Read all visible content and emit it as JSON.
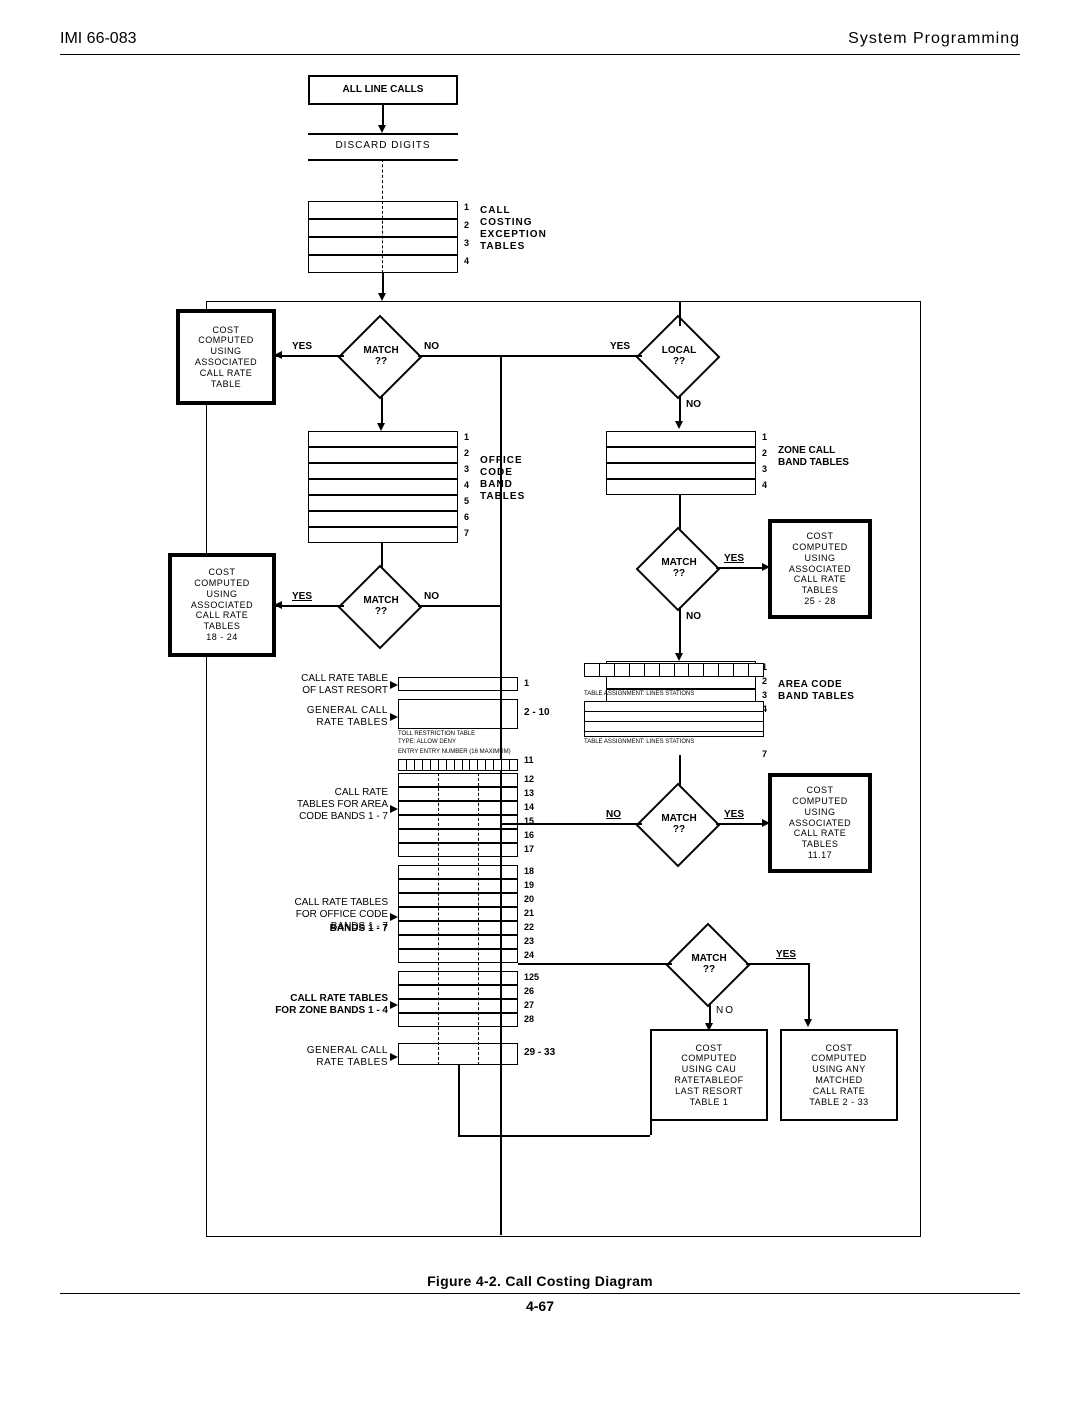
{
  "header": {
    "left": "IMI 66-083",
    "right": "System Programming"
  },
  "caption": "Figure 4-2. Call Costing Diagram",
  "page_number": "4-67",
  "start": "ALL LINE CALLS",
  "step_discard": "DISCARD DIGITS",
  "labels": {
    "call_costing_exception": "CALL\nCOSTING\nEXCEPTION\nTABLES",
    "cost_assoc_rate_table": "COST\nCOMPUTED\nUSING\nASSOCIATED\nCALL RATE\nTABLE",
    "office_code_band": "OFFICE\nCODE\nBAND\nTABLES",
    "zone_call_band": "ZONE CALL\nBAND TABLES",
    "cost_assoc_25_28": "COST\nCOMPUTED\nUSING\nASSOCIATED\nCALL RATE\nTABLES\n25 - 28",
    "cost_assoc_18_24": "COST\nCOMPUTED\nUSING\nASSOCIATED\nCALL RATE\nTABLES\n18 - 24",
    "area_code_band": "AREA CODE\nBAND TABLES",
    "call_rate_last_resort": "CALL RATE TABLE\nOF LAST RESORT",
    "general_call_rate": "GENERAL CALL\nRATE TABLES",
    "call_rate_area_1_7": "CALL RATE\nTABLES FOR AREA\nCODE BANDS 1 - 7",
    "cost_assoc_11_17": "COST\nCOMPUTED\nUSING\nASSOCIATED\nCALL RATE\nTABLES\n11.17",
    "call_rate_office_1_7": "CALL RATE TABLES\nFOR OFFICE CODE\nBANDS 1 - 7",
    "call_rate_zone_1_4": "CALL RATE TABLES\nFOR ZONE BANDS 1 - 4",
    "general_call_rate2": "GENERAL CALL\nRATE TABLES",
    "cost_last_resort_t1": "COST\nCOMPUTED\nUSING CAU\nRATETABLEOF\nLAST RESORT\nTABLE 1",
    "cost_matched_2_33": "COST\nCOMPUTED\nUSING ANY\nMATCHED\nCALL RATE\nTABLE 2 - 33",
    "toll_restriction": "TOLL RESTRICTION TABLE",
    "type_allow_deny": "TYPE: ALLOW    DENY",
    "entry_num": "ENTRY    ENTRY NUMBER (16 MAXIMUM)",
    "table_assignment": "TABLE ASSIGNMENT: LINES     STATIONS"
  },
  "decisions": {
    "match": "MATCH\n??",
    "local": "LOCAL\n??"
  },
  "yn": {
    "yes": "YES",
    "no": "NO"
  },
  "range_2_10": "2 - 10",
  "range_29_33": "29 - 33",
  "bands_1_7": "BANDS 1 - 7",
  "exception_nums": [
    "1",
    "2",
    "3",
    "4"
  ],
  "office_nums": [
    "1",
    "2",
    "3",
    "4",
    "5",
    "6",
    "7"
  ],
  "zone_nums": [
    "1",
    "2",
    "3",
    "4"
  ],
  "area_nums": [
    "1",
    "2",
    "3",
    "4",
    "7"
  ],
  "rate_nums": [
    "1",
    "",
    "11",
    "12",
    "13",
    "14",
    "15",
    "16",
    "17",
    "18",
    "19",
    "20",
    "21",
    "22",
    "23",
    "24",
    "125",
    "26",
    "27",
    "28",
    ""
  ]
}
